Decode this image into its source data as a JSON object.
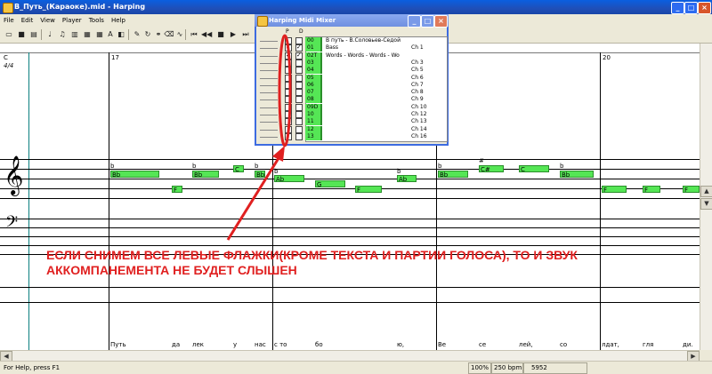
{
  "window": {
    "title": "В_Путь_(Караоке).mid - Harping"
  },
  "menu": [
    "File",
    "Edit",
    "View",
    "Player",
    "Tools",
    "Help"
  ],
  "score": {
    "chord": "C",
    "time_signature": "4/4",
    "measures": [
      "17",
      "20"
    ],
    "notes": [
      {
        "label": "Bb",
        "accidental": "b"
      },
      {
        "label": "F",
        "accidental": ""
      },
      {
        "label": "Bb",
        "accidental": "b"
      },
      {
        "label": "C",
        "accidental": ""
      },
      {
        "label": "Bb",
        "accidental": "b"
      },
      {
        "label": "Ab",
        "accidental": "b"
      },
      {
        "label": "G",
        "accidental": ""
      },
      {
        "label": "F",
        "accidental": ""
      },
      {
        "label": "Ab",
        "accidental": "b"
      },
      {
        "label": "Bb",
        "accidental": "b"
      },
      {
        "label": "C#",
        "accidental": "#"
      },
      {
        "label": "C",
        "accidental": ""
      },
      {
        "label": "Bb",
        "accidental": "b"
      },
      {
        "label": "F",
        "accidental": ""
      },
      {
        "label": "F",
        "accidental": ""
      },
      {
        "label": "F",
        "accidental": ""
      }
    ],
    "lyrics": [
      "Путь",
      "да",
      "лек",
      "у",
      "нас",
      "с то",
      "бо",
      "ю,",
      "Ве",
      "се",
      "лей,",
      "со",
      "лдат,",
      "гля",
      "ди."
    ]
  },
  "mixer": {
    "title": "Harping Midi Mixer",
    "header_p": "P",
    "header_d": "D",
    "rows": [
      {
        "num": "00",
        "name": "В путь - В.Соловьев-Седой",
        "channel": "",
        "p": false,
        "d": false
      },
      {
        "num": "01",
        "name": "Bass",
        "channel": "Ch 1",
        "p": true,
        "d": true
      },
      {
        "num": "02T",
        "name": "Words - Words - Words - Wo",
        "channel": "",
        "p": true,
        "d": true
      },
      {
        "num": "03",
        "name": "",
        "channel": "Ch 3",
        "p": false,
        "d": false
      },
      {
        "num": "04",
        "name": "",
        "channel": "Ch 5",
        "p": false,
        "d": false
      },
      {
        "num": "05",
        "name": "",
        "channel": "Ch 6",
        "p": false,
        "d": false
      },
      {
        "num": "06",
        "name": "",
        "channel": "Ch 7",
        "p": false,
        "d": false
      },
      {
        "num": "07",
        "name": "",
        "channel": "Ch 8",
        "p": false,
        "d": false
      },
      {
        "num": "08",
        "name": "",
        "channel": "Ch 9",
        "p": false,
        "d": false
      },
      {
        "num": "09D",
        "name": "",
        "channel": "Ch 10",
        "p": false,
        "d": false
      },
      {
        "num": "10",
        "name": "",
        "channel": "Ch 12",
        "p": false,
        "d": false
      },
      {
        "num": "11",
        "name": "",
        "channel": "Ch 13",
        "p": false,
        "d": false
      },
      {
        "num": "12",
        "name": "",
        "channel": "Ch 14",
        "p": false,
        "d": false
      },
      {
        "num": "13",
        "name": "",
        "channel": "Ch 16",
        "p": false,
        "d": false
      }
    ]
  },
  "annotation": {
    "line1": "ЕСЛИ СНИМЕМ ВСЕ ЛЕВЫЕ ФЛАЖКИ(КРОМЕ ТЕКСТА И ПАРТИИ ГОЛОСА), ТО И ЗВУК",
    "line2": "АККОМПАНЕМЕНТА НЕ БУДЕТ СЛЫШЕН",
    "color": "#e02020"
  },
  "status": {
    "help": "For Help, press F1",
    "zoom": "100%",
    "tempo": "250 bpm",
    "position": "5952"
  },
  "colors": {
    "note": "#55e655",
    "titlebar": "#1f4fb8"
  }
}
